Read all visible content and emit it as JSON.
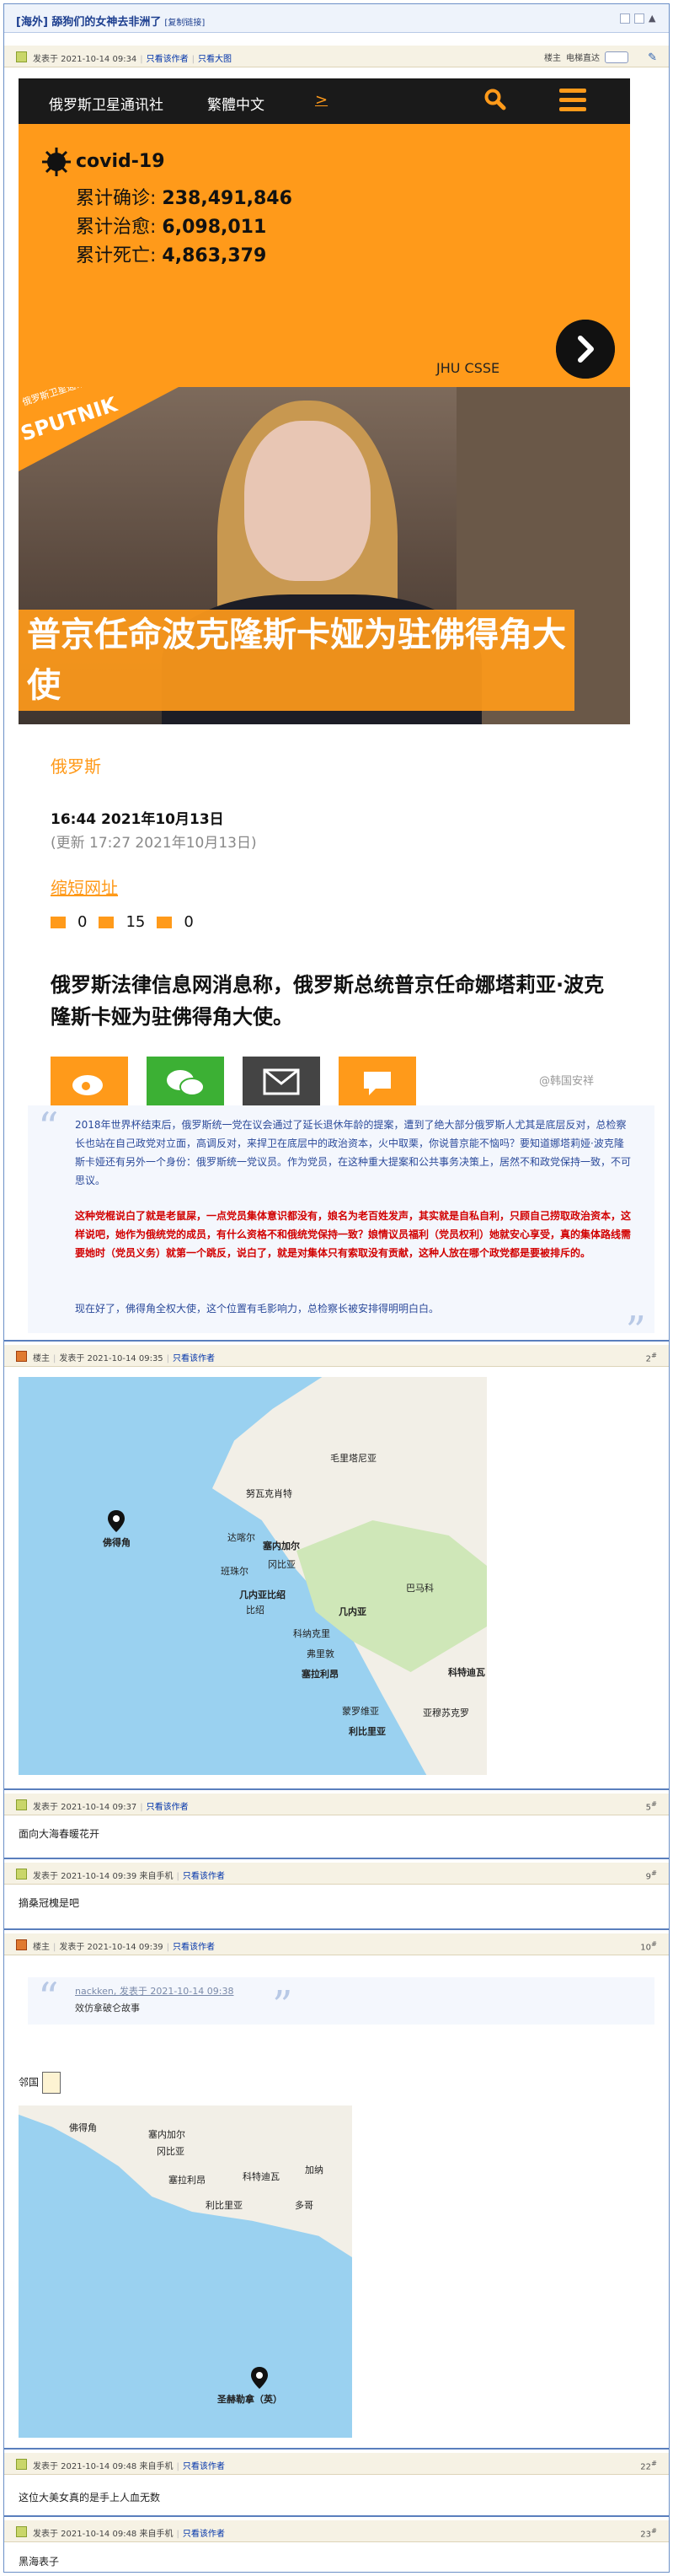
{
  "header": {
    "title": "[海外] 舔狗们的女神去非洲了",
    "tag": "[复制链接]"
  },
  "main_post": {
    "author": "楼主",
    "meta": "发表于 2021-10-14 09:34",
    "only_author": "只看该作者",
    "big_image": "只看大图",
    "lz_label": "楼主",
    "lz_mode": "电梯直达",
    "floor": ""
  },
  "article": {
    "site": "俄罗斯卫星通讯社",
    "traditional": "繁體中文",
    "arrow": ">",
    "covid_title": "covid-19",
    "rows": [
      {
        "label": "累计确诊:",
        "value": "238,491,846"
      },
      {
        "label": "累计治愈:",
        "value": "6,098,011"
      },
      {
        "label": "累计死亡:",
        "value": "4,863,379"
      }
    ],
    "source": "JHU CSSE",
    "brand_top": "俄罗斯卫星通讯社",
    "brand": "SPUTNIK",
    "headline_1": "普京任命波克隆斯卡娅为驻佛得角大",
    "headline_2": "使",
    "category": "俄罗斯",
    "time": "16:44 2021年10月13日",
    "updated": "(更新 17:27 2021年10月13日)",
    "short_url": "缩短网址",
    "reactions": [
      "0",
      "15",
      "0"
    ],
    "lead": "俄罗斯法律信息网消息称，俄罗斯总统普京任命娜塔莉亚·波克隆斯卡娅为驻佛得角大使。",
    "watermark": "@韩国安祥"
  },
  "quote1": {
    "p1": "2018年世界杯结束后，俄罗斯统一党在议会通过了延长退休年龄的提案，遭到了绝大部分俄罗斯人尤其是底层反对，总检察长也站在自己政党对立面，高调反对，来捍卫在底层中的政治资本，火中取栗，你说普京能不恼吗？要知道娜塔莉娅·波克隆斯卡娅还有另外一个身份：俄罗斯统一党议员。作为党员，在这种重大提案和公共事务决策上，居然不和政党保持一致，不可思议。",
    "p2": "这种党棍说白了就是老鼠屎，一点党员集体意识都没有，娘名为老百姓发声，其实就是自私自利，只顾自己捞取政治资本，这样说吧，她作为俄统党的成员，有什么资格不和俄统党保持一致？娘情议员福利（党员权利）她就安心享受，真的集体路线需要她时（党员义务）就第一个跳反，说白了，就是对集体只有索取没有贡献，这种人放在哪个政党都是要被排斥的。",
    "p3": "现在好了，佛得角全权大使，这个位置有毛影响力，总检察长被安排得明明白白。"
  },
  "post2": {
    "author": "楼主",
    "meta": "发表于 2021-10-14 09:35",
    "only": "只看该作者",
    "floor": "2"
  },
  "map1": {
    "labels": [
      "毛里塔尼亚",
      "佛得角",
      "努瓦克肖特",
      "达喀尔",
      "塞内加尔",
      "冈比亚",
      "班珠尔",
      "几内亚比绍",
      "比绍",
      "几内亚",
      "巴马科",
      "科纳克里",
      "弗里敦",
      "塞拉利昂",
      "蒙罗维亚",
      "利比里亚",
      "亚穆苏克罗",
      "科特迪瓦"
    ]
  },
  "post5": {
    "meta": "发表于 2021-10-14 09:37",
    "only": "只看该作者",
    "floor": "5",
    "text": "面向大海春暖花开"
  },
  "post9": {
    "meta": "发表于 2021-10-14 09:39 来自手机",
    "only": "只看该作者",
    "floor": "9",
    "text": "摘桑冠槐是吧"
  },
  "post10": {
    "author": "楼主",
    "meta": "发表于 2021-10-14 09:39",
    "only": "只看该作者",
    "floor": "10",
    "quote_user": "nackken, 发表于 2021-10-14 09:38",
    "quote_text": "效仿拿破仑故事",
    "text": "邻国"
  },
  "map2": {
    "labels": [
      "佛得角",
      "塞内加尔",
      "冈比亚",
      "塞拉利昂",
      "利比里亚",
      "科特迪瓦",
      "加纳",
      "多哥",
      "圣赫勒拿（英）"
    ]
  },
  "post22": {
    "meta": "发表于 2021-10-14 09:48 来自手机",
    "only": "只看该作者",
    "floor": "22",
    "text": "这位大美女真的是手上人血无数"
  },
  "post23": {
    "meta": "发表于 2021-10-14 09:48 来自手机",
    "only": "只看该作者",
    "floor": "23",
    "text": "黑海表子"
  }
}
